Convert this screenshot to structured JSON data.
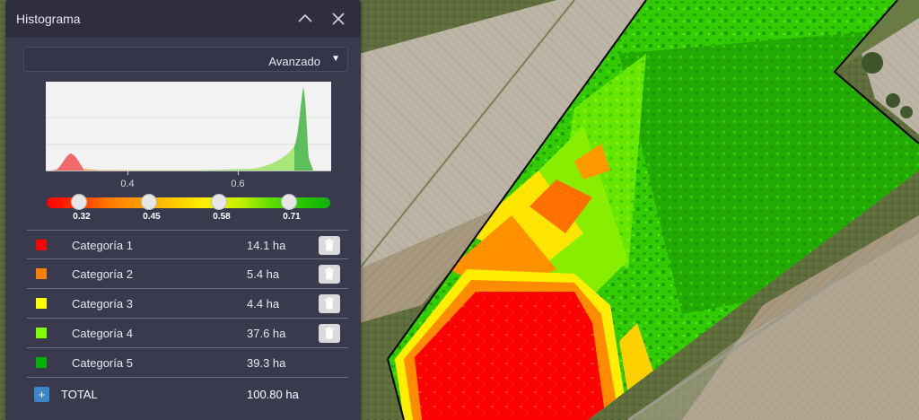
{
  "panel": {
    "title": "Histograma",
    "mode_select": {
      "value": "Avanzado"
    },
    "collapse_icon": "chevron-up-icon",
    "close_icon": "close-icon"
  },
  "histogram": {
    "x_ticks": [
      "0.4",
      "0.6"
    ],
    "thresholds": [
      "0.32",
      "0.45",
      "0.58",
      "0.71"
    ],
    "gradient_colors": [
      "#ff0000",
      "#ff7a00",
      "#ffee00",
      "#66e000",
      "#10b010"
    ]
  },
  "categories": [
    {
      "name": "Categoría 1",
      "area": "14.1 ha",
      "color": "#ff0000",
      "deletable": true
    },
    {
      "name": "Categoría 2",
      "area": "5.4 ha",
      "color": "#ff8000",
      "deletable": true
    },
    {
      "name": "Categoría 3",
      "area": "4.4 ha",
      "color": "#ffff00",
      "deletable": true
    },
    {
      "name": "Categoría 4",
      "area": "37.6 ha",
      "color": "#80ff00",
      "deletable": true
    },
    {
      "name": "Categoría 5",
      "area": "39.3 ha",
      "color": "#00b000",
      "deletable": false
    }
  ],
  "total": {
    "label": "TOTAL",
    "area": "100.80 ha"
  }
}
